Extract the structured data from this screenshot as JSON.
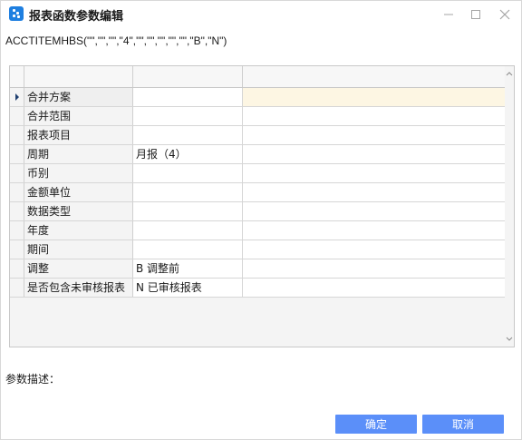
{
  "window": {
    "title": "报表函数参数编辑",
    "app_icon": "spreadsheet-dots-icon",
    "controls": [
      "minimize-icon",
      "maximize-icon",
      "close-icon"
    ]
  },
  "formula": "ACCTITEMHBS(\"\",\"\",\"\",\"4\",\"\",\"\",\"\",\"\",\"\",\"B\",\"N\")",
  "grid": {
    "columns": [
      "",
      "",
      ""
    ],
    "rows": [
      {
        "name": "合并方案",
        "value": "",
        "active": true
      },
      {
        "name": "合并范围",
        "value": ""
      },
      {
        "name": "报表项目",
        "value": ""
      },
      {
        "name": "周期",
        "value": "月报（4）"
      },
      {
        "name": "币别",
        "value": ""
      },
      {
        "name": "金额单位",
        "value": ""
      },
      {
        "name": "数据类型",
        "value": ""
      },
      {
        "name": "年度",
        "value": ""
      },
      {
        "name": "期间",
        "value": ""
      },
      {
        "name": "调整",
        "value": "B  调整前"
      },
      {
        "name": "是否包含未审核报表",
        "value": "N  已审核报表"
      }
    ]
  },
  "param_desc_label": "参数描述：",
  "buttons": {
    "ok": "确定",
    "cancel": "取消"
  },
  "colors": {
    "accent": "#5b8ff9",
    "selected_row_highlight": "#fdf6e3",
    "app_icon": "#1e7fe0"
  }
}
